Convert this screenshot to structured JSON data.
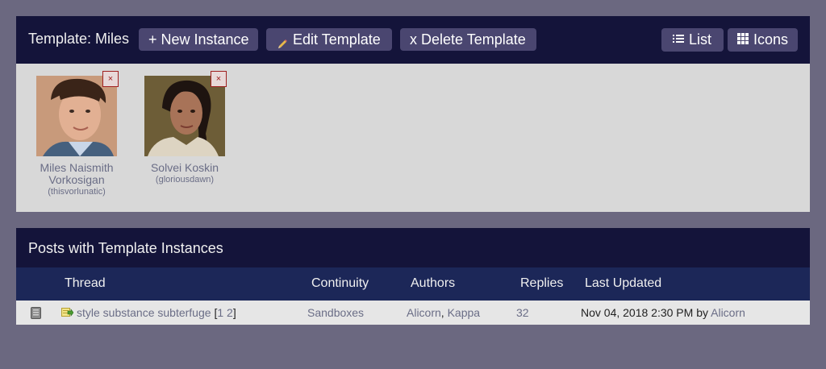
{
  "template": {
    "title": "Template: Miles",
    "buttons": {
      "new_instance": "+ New Instance",
      "edit_template": "Edit Template",
      "delete_template": "x Delete Template",
      "list": "List",
      "icons": "Icons"
    },
    "characters": [
      {
        "name": "Miles Naismith Vorkosigan",
        "handle": "(thisvorlunatic)",
        "delete_label": "×"
      },
      {
        "name": "Solvei Koskin",
        "handle": "(gloriousdawn)",
        "delete_label": "×"
      }
    ]
  },
  "posts": {
    "title": "Posts with Template Instances",
    "columns": {
      "thread": "Thread",
      "continuity": "Continuity",
      "authors": "Authors",
      "replies": "Replies",
      "last_updated": "Last Updated"
    },
    "rows": [
      {
        "thread": "style substance subterfuge",
        "page_open": "[",
        "page_1": "1",
        "page_2": "2",
        "page_close": "]",
        "continuity": "Sandboxes",
        "author_1": "Alicorn",
        "author_sep": ",",
        "author_2": "Kappa",
        "replies": "32",
        "updated": "Nov 04, 2018 2:30 PM",
        "updated_by": "by",
        "updated_author": "Alicorn"
      }
    ]
  },
  "colors": {
    "page_bg": "#6b6880",
    "header_bg": "#14143a",
    "column_header_bg": "#1c2758",
    "button_bg": "#4a4670",
    "link": "#6a6d86"
  }
}
